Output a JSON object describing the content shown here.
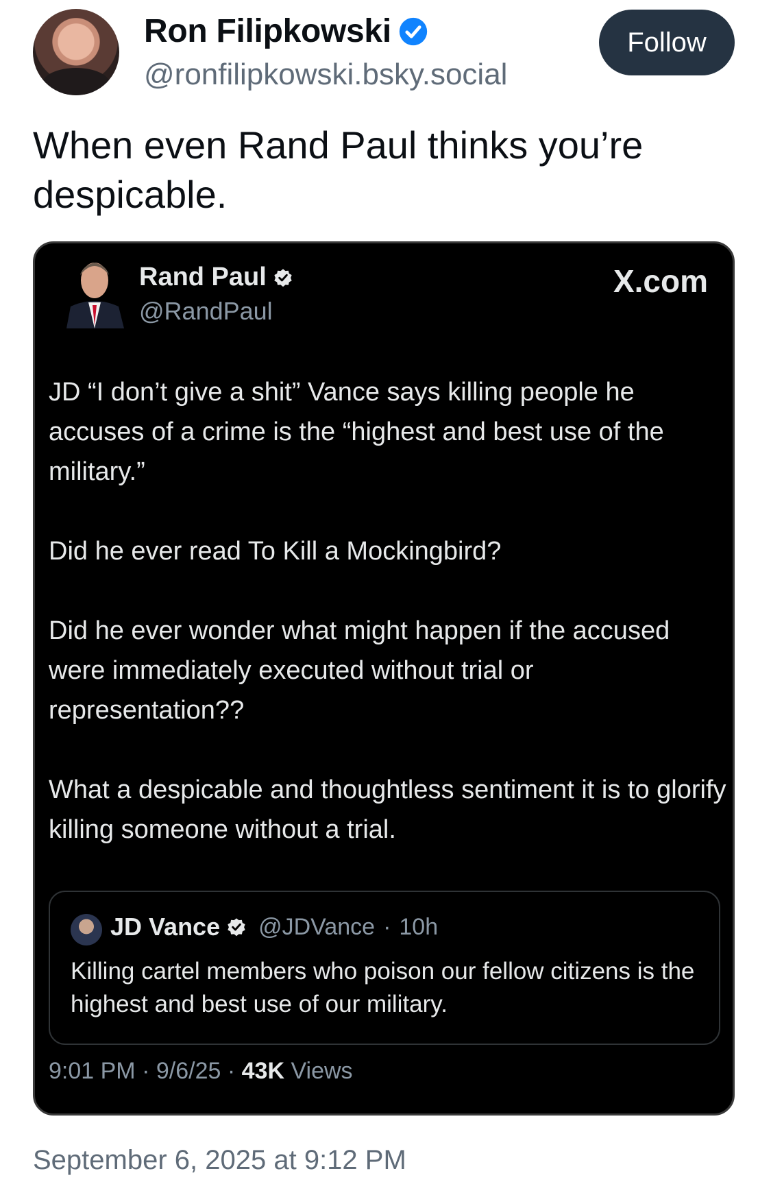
{
  "post": {
    "author_name": "Ron Filipkowski",
    "author_handle": "@ronfilipkowski.bsky.social",
    "follow_label": "Follow",
    "text": "When even Rand Paul thinks you’re despicable.",
    "date": "September 6, 2025 at 9:12 PM"
  },
  "embed": {
    "author_name": "Rand Paul",
    "author_handle": "@RandPaul",
    "source": "X.com",
    "paragraphs": [
      "JD “I don’t give a shit” Vance says killing people he accuses of a crime is the “highest and best use of the military.”",
      "Did he ever read To Kill a Mockingbird?",
      "Did he ever wonder what might happen if the accused were immediately executed without trial or representation??",
      "What a despicable and thoughtless sentiment it is to glorify killing someone without a trial."
    ],
    "quote": {
      "author_name": "JD Vance",
      "author_handle": "@JDVance",
      "age": "10h",
      "text": "Killing cartel members who poison our fellow citizens is the highest and best use of our military."
    },
    "meta": {
      "time": "9:01 PM",
      "date": "9/6/25",
      "views_count": "43K",
      "views_label": "Views"
    }
  },
  "colors": {
    "verified_blue": "#1083fe",
    "follow_bg": "#253342",
    "embed_bg": "#000000"
  }
}
